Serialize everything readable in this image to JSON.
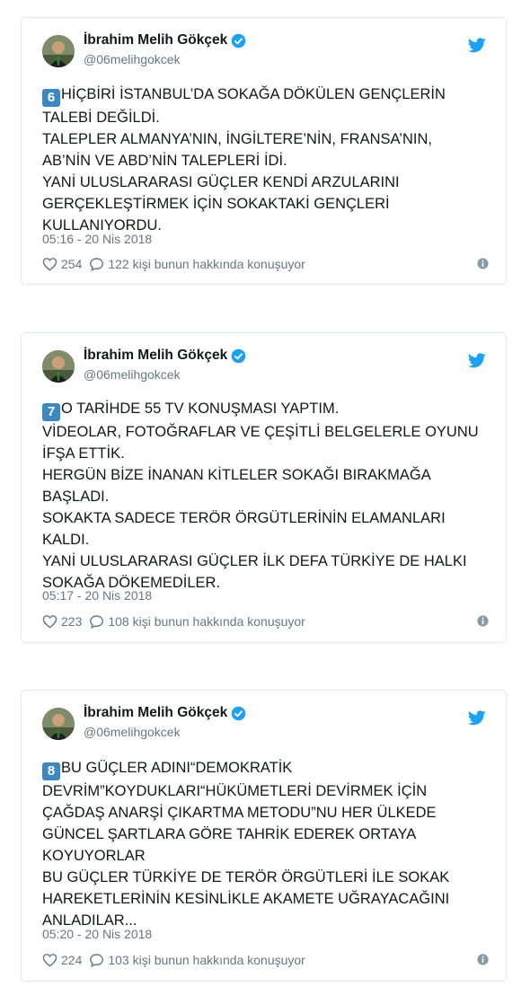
{
  "tweets": [
    {
      "author_name": "İbrahim Melih Gökçek",
      "handle": "@06melihgokcek",
      "number_badge": "6",
      "lines": [
        "HİÇBİRİ İSTANBUL’DA SOKAĞA DÖKÜLEN GENÇLERİN",
        "TALEBİ DEĞİLDİ.",
        "TALEPLER ALMANYA’NIN, İNGİLTERE’NİN, FRANSA’NIN,",
        "AB’NİN VE ABD’NİN TALEPLERİ İDİ.",
        "YANİ ULUSLARARASI GÜÇLER KENDİ ARZULARINI",
        "GERÇEKLEŞTİRMEK İÇİN SOKAKTAKİ GENÇLERİ",
        "KULLANIYORDU."
      ],
      "timestamp": "05:16 - 20 Nis 2018",
      "likes": "254",
      "replies": "122 kişi bunun hakkında konuşuyor"
    },
    {
      "author_name": "İbrahim Melih Gökçek",
      "handle": "@06melihgokcek",
      "number_badge": "7",
      "lines": [
        "O TARİHDE 55 TV KONUŞMASI YAPTIM.",
        "VİDEOLAR, FOTOĞRAFLAR VE ÇEŞİTLİ BELGELERLE OYUNU",
        "İFŞA ETTİK.",
        "HERGÜN BİZE İNANAN KİTLELER SOKAĞI BIRAKMAĞA",
        "BAŞLADI.",
        "SOKAKTA SADECE TERÖR ÖRGÜTLERİNİN ELAMANLARI",
        "KALDI.",
        "YANİ ULUSLARARASI GÜÇLER İLK DEFA TÜRKİYE DE HALKI",
        "SOKAĞA DÖKEMEDİLER."
      ],
      "timestamp": "05:17 - 20 Nis 2018",
      "likes": "223",
      "replies": "108 kişi bunun hakkında konuşuyor"
    },
    {
      "author_name": "İbrahim Melih Gökçek",
      "handle": "@06melihgokcek",
      "number_badge": "8",
      "lines": [
        "BU GÜÇLER ADINI“DEMOKRATİK",
        "DEVRİM”KOYDUKLARI“HÜKÜMETLERİ DEVİRMEK İÇİN",
        "ÇAĞDAŞ ANARŞİ ÇIKARTMA METODU”NU HER ÜLKEDE",
        "GÜNCEL ŞARTLARA GÖRE TAHRİK EDEREK ORTAYA",
        "KOYUYORLAR",
        "BU GÜÇLER TÜRKİYE DE TERÖR ÖRGÜTLERİ İLE SOKAK",
        "HAREKETLERİNİN KESİNLİKLE AKAMETE UĞRAYACAĞINI",
        "ANLADILAR..."
      ],
      "timestamp": "05:20 - 20 Nis 2018",
      "likes": "224",
      "replies": "103 kişi bunun hakkında konuşuyor"
    }
  ],
  "colors": {
    "twitter_blue": "#1da1f2",
    "badge_blue": "#3b88c3",
    "muted_text": "#657786",
    "border": "#e1e8ed"
  },
  "icons": [
    "verified-badge-icon",
    "twitter-bird-icon",
    "heart-icon",
    "reply-bubble-icon",
    "info-icon"
  ]
}
